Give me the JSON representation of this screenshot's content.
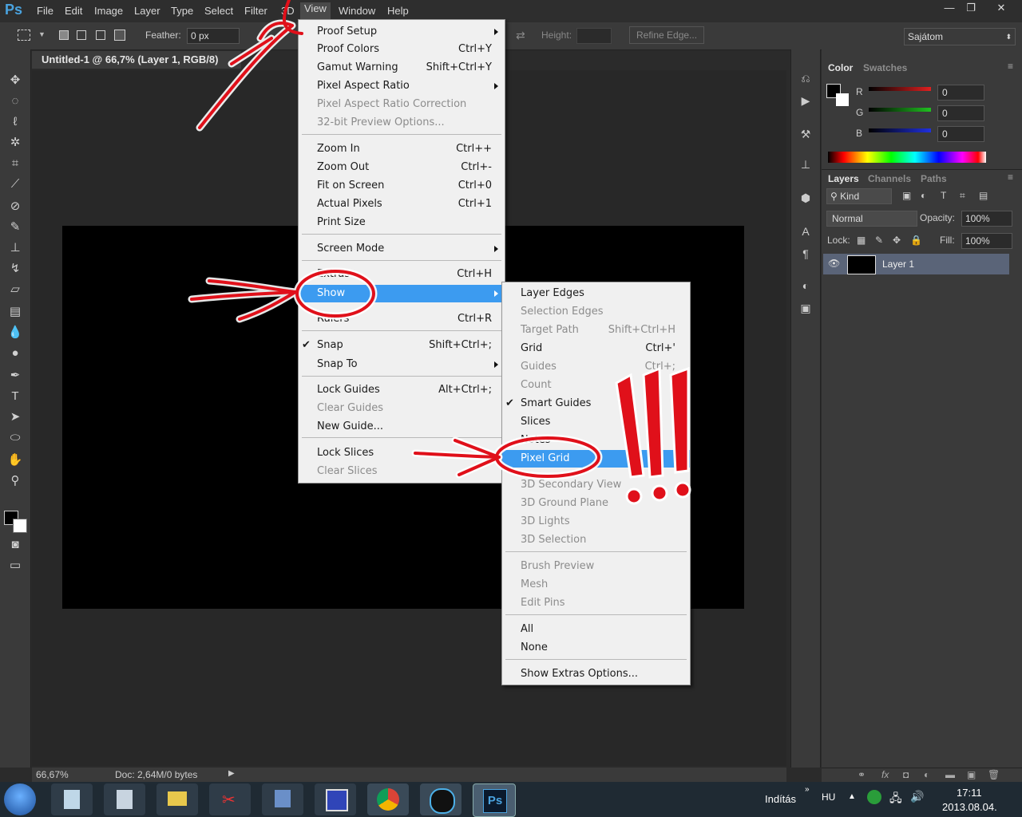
{
  "app": {
    "logo": "Ps"
  },
  "menubar": {
    "items": [
      "File",
      "Edit",
      "Image",
      "Layer",
      "Type",
      "Select",
      "Filter",
      "3D",
      "View",
      "Window",
      "Help"
    ],
    "window_controls": {
      "minimize": "—",
      "restore": "❐",
      "close": "✕"
    }
  },
  "options": {
    "feather_label": "Feather:",
    "feather_value": "0 px",
    "height_label": "Height:",
    "refine_edge": "Refine Edge...",
    "workspace": "Sajátom"
  },
  "document": {
    "tab_title": "Untitled-1 @ 66,7% (Layer 1, RGB/8)",
    "zoom": "66,67%",
    "doc_info": "Doc: 2,64M/0 bytes"
  },
  "view_menu": {
    "items": [
      {
        "label": "Proof Setup",
        "shortcut": "",
        "submenu": true,
        "disabled": false
      },
      {
        "label": "Proof Colors",
        "shortcut": "Ctrl+Y",
        "disabled": false
      },
      {
        "label": "Gamut Warning",
        "shortcut": "Shift+Ctrl+Y",
        "disabled": false
      },
      {
        "label": "Pixel Aspect Ratio",
        "shortcut": "",
        "submenu": true,
        "disabled": false
      },
      {
        "label": "Pixel Aspect Ratio Correction",
        "shortcut": "",
        "disabled": true
      },
      {
        "label": "32-bit Preview Options...",
        "shortcut": "",
        "disabled": true
      },
      {
        "label": "Zoom In",
        "shortcut": "Ctrl++",
        "disabled": false
      },
      {
        "label": "Zoom Out",
        "shortcut": "Ctrl+-",
        "disabled": false
      },
      {
        "label": "Fit on Screen",
        "shortcut": "Ctrl+0",
        "disabled": false
      },
      {
        "label": "Actual Pixels",
        "shortcut": "Ctrl+1",
        "disabled": false
      },
      {
        "label": "Print Size",
        "shortcut": "",
        "disabled": false
      },
      {
        "label": "Screen Mode",
        "shortcut": "",
        "submenu": true,
        "disabled": false
      },
      {
        "label": "Extras",
        "shortcut": "Ctrl+H",
        "disabled": false
      },
      {
        "label": "Show",
        "shortcut": "",
        "submenu": true,
        "highlighted": true,
        "disabled": false
      },
      {
        "label": "Rulers",
        "shortcut": "Ctrl+R",
        "disabled": false
      },
      {
        "label": "Snap",
        "shortcut": "Shift+Ctrl+;",
        "checked": true,
        "disabled": false
      },
      {
        "label": "Snap To",
        "shortcut": "",
        "submenu": true,
        "disabled": false
      },
      {
        "label": "Lock Guides",
        "shortcut": "Alt+Ctrl+;",
        "disabled": false
      },
      {
        "label": "Clear Guides",
        "shortcut": "",
        "disabled": true
      },
      {
        "label": "New Guide...",
        "shortcut": "",
        "disabled": false
      },
      {
        "label": "Lock Slices",
        "shortcut": "",
        "disabled": false
      },
      {
        "label": "Clear Slices",
        "shortcut": "",
        "disabled": true
      }
    ]
  },
  "show_submenu": {
    "items": [
      {
        "label": "Layer Edges",
        "shortcut": "",
        "disabled": false
      },
      {
        "label": "Selection Edges",
        "shortcut": "",
        "disabled": true
      },
      {
        "label": "Target Path",
        "shortcut": "Shift+Ctrl+H",
        "disabled": true
      },
      {
        "label": "Grid",
        "shortcut": "Ctrl+'",
        "disabled": false
      },
      {
        "label": "Guides",
        "shortcut": "Ctrl+;",
        "disabled": true
      },
      {
        "label": "Count",
        "shortcut": "",
        "disabled": true
      },
      {
        "label": "Smart Guides",
        "shortcut": "",
        "checked": true,
        "disabled": false
      },
      {
        "label": "Slices",
        "shortcut": "",
        "disabled": false
      },
      {
        "label": "Notes",
        "shortcut": "",
        "disabled": false
      },
      {
        "label": "Pixel Grid",
        "shortcut": "",
        "highlighted": true,
        "disabled": false
      },
      {
        "label": "3D Secondary View",
        "shortcut": "",
        "disabled": true
      },
      {
        "label": "3D Ground Plane",
        "shortcut": "",
        "disabled": true
      },
      {
        "label": "3D Lights",
        "shortcut": "",
        "disabled": true
      },
      {
        "label": "3D Selection",
        "shortcut": "",
        "disabled": true
      },
      {
        "label": "Brush Preview",
        "shortcut": "",
        "disabled": true
      },
      {
        "label": "Mesh",
        "shortcut": "",
        "disabled": true
      },
      {
        "label": "Edit Pins",
        "shortcut": "",
        "disabled": true
      },
      {
        "label": "All",
        "shortcut": "",
        "disabled": false
      },
      {
        "label": "None",
        "shortcut": "",
        "disabled": false
      },
      {
        "label": "Show Extras Options...",
        "shortcut": "",
        "disabled": false
      }
    ]
  },
  "color_panel": {
    "tabs": [
      "Color",
      "Swatches"
    ],
    "channels": [
      {
        "label": "R",
        "value": "0",
        "color": "#e02020"
      },
      {
        "label": "G",
        "value": "0",
        "color": "#20c020"
      },
      {
        "label": "B",
        "value": "0",
        "color": "#2030e0"
      }
    ]
  },
  "layers_panel": {
    "tabs": [
      "Layers",
      "Channels",
      "Paths"
    ],
    "filter_kind": "Kind",
    "blend_mode": "Normal",
    "opacity_label": "Opacity:",
    "opacity_value": "100%",
    "lock_label": "Lock:",
    "fill_label": "Fill:",
    "fill_value": "100%",
    "layers": [
      {
        "name": "Layer 1",
        "visible": true
      }
    ]
  },
  "taskbar": {
    "language_label": "Indítás",
    "locale": "HU",
    "time": "17:11",
    "date": "2013.08.04."
  },
  "annotation": {
    "text": "!!!",
    "color": "#e0101a"
  }
}
